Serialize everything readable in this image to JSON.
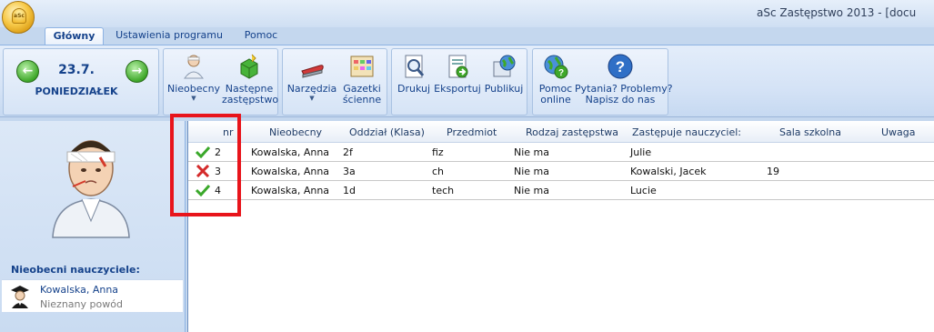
{
  "window": {
    "title": "aSc Zastępstwo 2013 - [docu",
    "orb_text": "aSc"
  },
  "tabs": [
    {
      "label": "Główny",
      "active": true
    },
    {
      "label": "Ustawienia programu",
      "active": false
    },
    {
      "label": "Pomoc",
      "active": false
    }
  ],
  "date_nav": {
    "date": "23.7.",
    "day": "PONIEDZIAŁEK"
  },
  "ribbon": {
    "absent_line1": "Nieobecny",
    "next_line1": "Następne",
    "next_line2": "zastępstwo",
    "tools_line1": "Narzędzia",
    "boards_line1": "Gazetki",
    "boards_line2": "ścienne",
    "print": "Drukuj",
    "export": "Eksportuj",
    "publish": "Publikuj",
    "help_line1": "Pomoc",
    "help_line2": "online",
    "questions_line1": "Pytania? Problemy?",
    "questions_line2": "Napisz do nas"
  },
  "sidebar": {
    "absent_title": "Nieobecni nauczyciele:",
    "absent_teacher": {
      "name": "Kowalska, Anna",
      "reason": "Nieznany powód"
    }
  },
  "grid": {
    "headers": {
      "nr": "nr",
      "absent": "Nieobecny",
      "class": "Oddział (Klasa)",
      "subject": "Przedmiot",
      "type": "Rodzaj zastępstwa",
      "substitute": "Zastępuje nauczyciel:",
      "room": "Sala szkolna",
      "note": "Uwaga"
    },
    "rows": [
      {
        "status": "ok",
        "nr": "2",
        "absent": "Kowalska, Anna",
        "class": "2f",
        "subject": "fiz",
        "type": "Nie ma",
        "substitute": "Julie",
        "room": "",
        "note": ""
      },
      {
        "status": "error",
        "nr": "3",
        "absent": "Kowalska, Anna",
        "class": "3a",
        "subject": "ch",
        "type": "Nie ma",
        "substitute": "Kowalski, Jacek",
        "room": "19",
        "note": ""
      },
      {
        "status": "ok",
        "nr": "4",
        "absent": "Kowalska, Anna",
        "class": "1d",
        "subject": "tech",
        "type": "Nie ma",
        "substitute": "Lucie",
        "room": "",
        "note": ""
      }
    ]
  },
  "colors": {
    "accent_text": "#15428b",
    "highlight_box": "#e8141b",
    "ok_check": "#3aa82a",
    "error_x": "#d42a2a"
  }
}
